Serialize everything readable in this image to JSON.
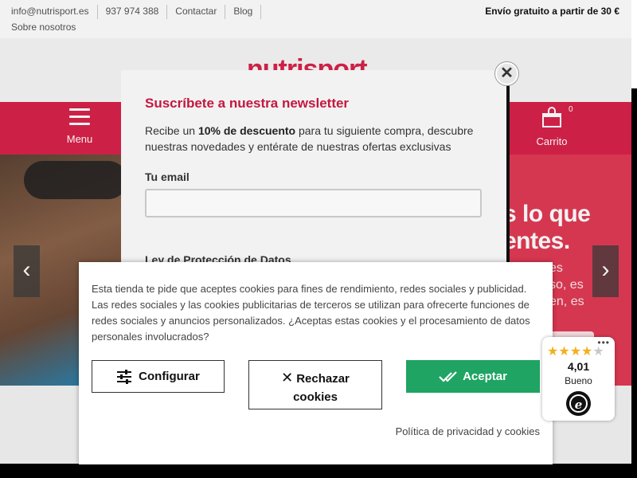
{
  "topbar": {
    "email": "info@nutrisport.es",
    "phone": "937 974 388",
    "contact": "Contactar",
    "blog": "Blog",
    "about": "Sobre nosotros",
    "shipping": "Envío gratuito a partir de 30 €"
  },
  "header": {
    "logo": "nutrisport",
    "menu_label": "Menu",
    "cart_label": "Carrito",
    "cart_count": "0"
  },
  "hero": {
    "headline_line1": "s lo que",
    "headline_line2": "entes.",
    "sub_line1": "es",
    "sub_line2": "so, es",
    "sub_line3": "en, es"
  },
  "newsletter": {
    "title": "Suscríbete a nuestra newsletter",
    "desc_prefix": "Recibe un ",
    "desc_bold": "10% de descuento",
    "desc_suffix": " para tu siguiente compra, descubre nuestras novedades y entérate de nuestras ofertas exclusivas",
    "email_label": "Tu email",
    "email_value": "",
    "privacy_heading": "Ley de Protección de Datos",
    "close_glyph": "✕"
  },
  "cookies": {
    "text": "Esta tienda te pide que aceptes cookies para fines de rendimiento, redes sociales y publicidad. Las redes sociales y las cookies publicitarias de terceros se utilizan para ofrecerte funciones de redes sociales y anuncios personalizados. ¿Aceptas estas cookies y el procesamiento de datos personales involucrados?",
    "configure_label": "Configurar",
    "reject_label_line1": "Rechazar",
    "reject_label_line2": "cookies",
    "accept_label": "Aceptar",
    "policy_link": "Política de privacidad y cookies"
  },
  "trust_badge": {
    "more": "•••",
    "rating": "4,01",
    "stars_value": 4,
    "stars_max": 5,
    "label": "Bueno",
    "logo_letter": "e"
  },
  "colors": {
    "brand_red": "#d9224a",
    "accept_green": "#1fa463",
    "star_gold": "#f2b01e"
  },
  "icons": {
    "menu": "hamburger-icon",
    "cart": "cart-icon",
    "configure": "sliders-icon",
    "reject": "close-icon",
    "accept": "double-check-icon",
    "slide_prev": "chevron-left-icon",
    "slide_next": "chevron-right-icon"
  }
}
